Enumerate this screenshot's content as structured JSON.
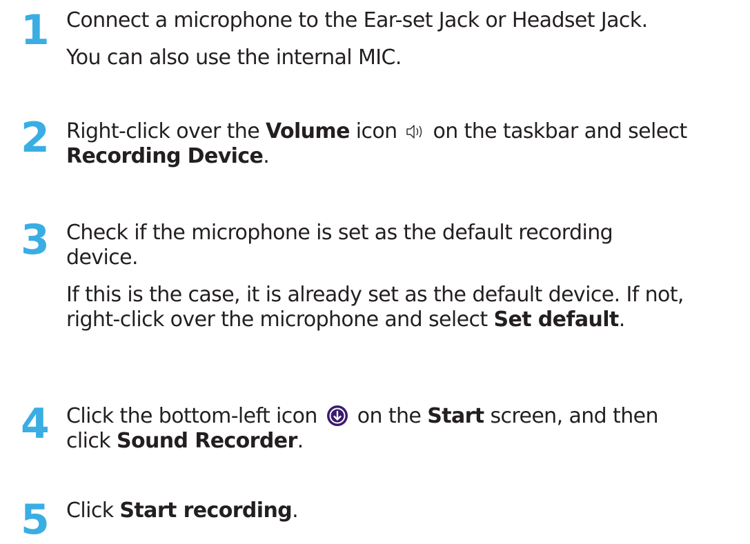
{
  "steps": [
    {
      "number": "1",
      "line1": "Connect a microphone to the Ear-set Jack or Headset Jack.",
      "line2": "You can also use the internal MIC."
    },
    {
      "number": "2",
      "pre": "Right-click over the ",
      "bold1": "Volume",
      "mid": " icon",
      "post": " on the taskbar and select",
      "bold2": "Recording Device",
      "end": "."
    },
    {
      "number": "3",
      "line1": "Check if the microphone is set as the default recording",
      "line2": "device.",
      "line3": "If this is the case, it is already set as the default device. If not,",
      "line4_pre": "right-click over the microphone and select ",
      "line4_bold": "Set default",
      "line4_end": "."
    },
    {
      "number": "4",
      "pre": "Click the bottom-left icon",
      "mid": " on the ",
      "bold1": "Start",
      "post": " screen, and then",
      "line2_pre": "click ",
      "bold2": "Sound Recorder",
      "end": "."
    },
    {
      "number": "5",
      "pre": "Click ",
      "bold1": "Start recording",
      "end": "."
    }
  ],
  "icons": {
    "volume": "speaker-volume-icon",
    "start": "down-arrow-circle-icon"
  },
  "colors": {
    "step_number": "#3aaee3",
    "text": "#231f20",
    "start_icon_fill": "#3a1b6e"
  }
}
